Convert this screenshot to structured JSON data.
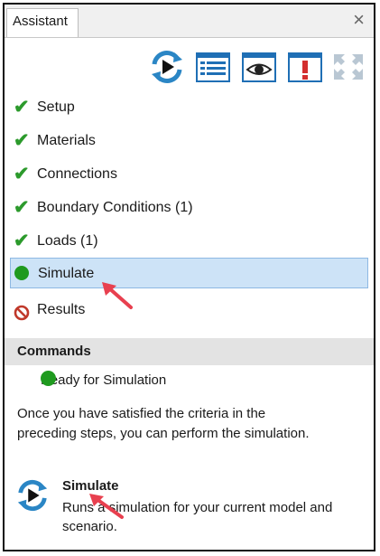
{
  "tab": {
    "title": "Assistant",
    "close": "×"
  },
  "toolbar": {
    "icons": [
      "simulate-icon",
      "list-icon",
      "eye-icon",
      "warning-icon",
      "refresh-disabled-icon"
    ]
  },
  "steps": [
    {
      "label": "Setup",
      "status": "complete"
    },
    {
      "label": "Materials",
      "status": "complete"
    },
    {
      "label": "Connections",
      "status": "complete"
    },
    {
      "label": "Boundary Conditions (1)",
      "status": "complete"
    },
    {
      "label": "Loads (1)",
      "status": "complete"
    },
    {
      "label": "Simulate",
      "status": "active"
    },
    {
      "label": "Results",
      "status": "blocked"
    }
  ],
  "commands": {
    "header": "Commands",
    "ready": "Ready for Simulation",
    "description": "Once you have satisfied the criteria in the preceding steps, you can perform the simulation.",
    "simulate_title": "Simulate",
    "simulate_desc": "Runs a simulation for your current model and scenario."
  },
  "colors": {
    "green": "#2c9a2c",
    "active_bg": "#cde3f7",
    "red": "#c0392b",
    "arrow": "#e8404f"
  }
}
